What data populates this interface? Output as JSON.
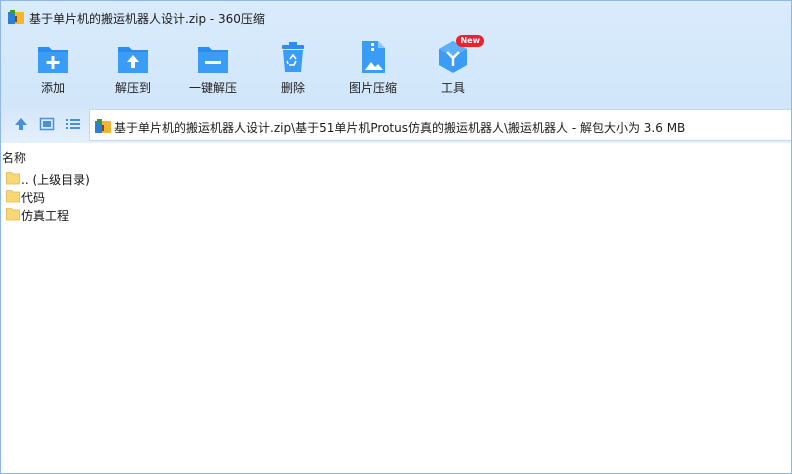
{
  "window": {
    "title": "基于单片机的搬运机器人设计.zip - 360压缩"
  },
  "toolbar": {
    "items": [
      {
        "label": "添加",
        "icon": "add-folder-icon"
      },
      {
        "label": "解压到",
        "icon": "extract-to-icon"
      },
      {
        "label": "一键解压",
        "icon": "one-click-extract-icon"
      },
      {
        "label": "删除",
        "icon": "recycle-bin-icon"
      },
      {
        "label": "图片压缩",
        "icon": "image-compress-icon"
      },
      {
        "label": "工具",
        "icon": "tools-cube-icon",
        "badge": "New"
      }
    ]
  },
  "addressbar": {
    "path": "基于单片机的搬运机器人设计.zip\\基于51单片机Protus仿真的搬运机器人\\搬运机器人 - 解包大小为 3.6 MB"
  },
  "filelist": {
    "column_name": "名称",
    "rows": [
      {
        "name": ".. (上级目录)"
      },
      {
        "name": "代码"
      },
      {
        "name": "仿真工程"
      }
    ]
  },
  "colors": {
    "accent": "#2a8ef0",
    "header_bg": "#d4e8fb",
    "folder": "#f8d775",
    "badge": "#e8252e"
  }
}
